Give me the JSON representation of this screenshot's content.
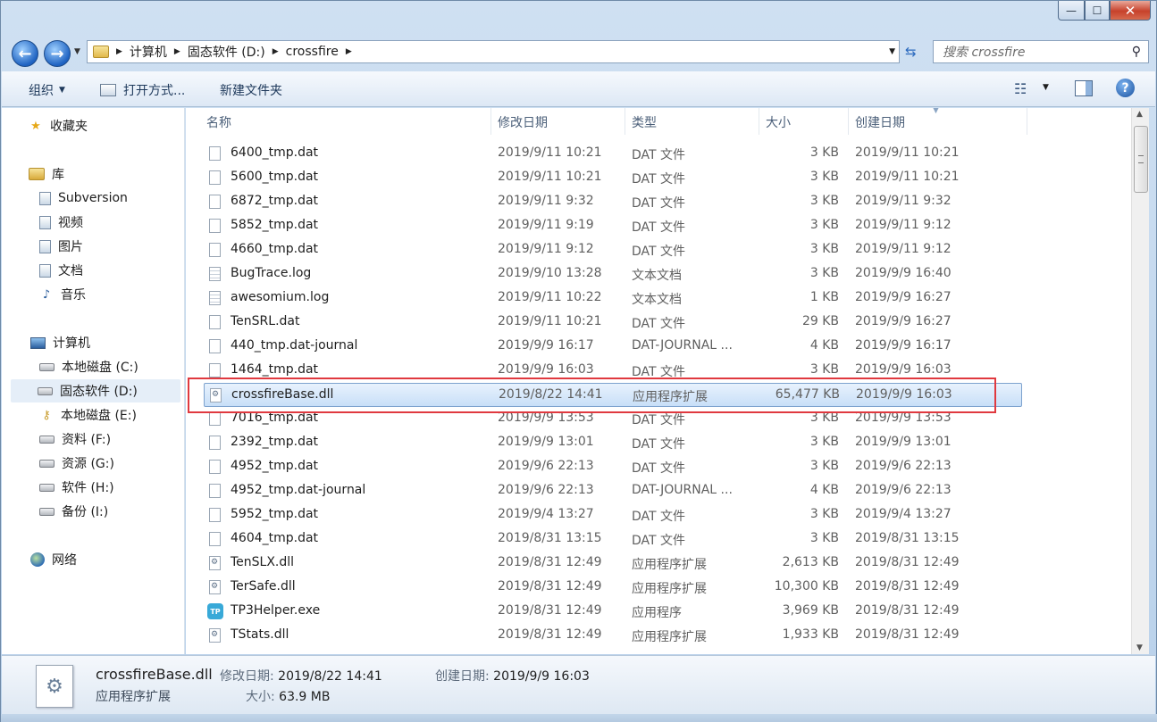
{
  "window": {
    "title": "",
    "controls": {
      "minimize": "—",
      "maximize": "☐",
      "close": "✕"
    }
  },
  "address": {
    "breadcrumbs": [
      "计算机",
      "固态软件 (D:)",
      "crossfire"
    ],
    "search_placeholder": "搜索 crossfire"
  },
  "toolbar": {
    "organize": "组织",
    "open_with": "打开方式...",
    "new_folder": "新建文件夹"
  },
  "nav": {
    "favorites": "收藏夹",
    "libraries": "库",
    "library_items": [
      "Subversion",
      "视频",
      "图片",
      "文档",
      "音乐"
    ],
    "computer": "计算机",
    "drives": [
      "本地磁盘 (C:)",
      "固态软件 (D:)",
      "本地磁盘 (E:)",
      "资料 (F:)",
      "资源 (G:)",
      "软件 (H:)",
      "备份 (I:)"
    ],
    "network": "网络"
  },
  "columns": {
    "name": "名称",
    "modified": "修改日期",
    "type": "类型",
    "size": "大小",
    "created": "创建日期"
  },
  "files": [
    {
      "name": "6400_tmp.dat",
      "modified": "2019/9/11 10:21",
      "type": "DAT 文件",
      "size": "3 KB",
      "created": "2019/9/11 10:21",
      "icon": "file"
    },
    {
      "name": "5600_tmp.dat",
      "modified": "2019/9/11 10:21",
      "type": "DAT 文件",
      "size": "3 KB",
      "created": "2019/9/11 10:21",
      "icon": "file"
    },
    {
      "name": "6872_tmp.dat",
      "modified": "2019/9/11 9:32",
      "type": "DAT 文件",
      "size": "3 KB",
      "created": "2019/9/11 9:32",
      "icon": "file"
    },
    {
      "name": "5852_tmp.dat",
      "modified": "2019/9/11 9:19",
      "type": "DAT 文件",
      "size": "3 KB",
      "created": "2019/9/11 9:12",
      "icon": "file"
    },
    {
      "name": "4660_tmp.dat",
      "modified": "2019/9/11 9:12",
      "type": "DAT 文件",
      "size": "3 KB",
      "created": "2019/9/11 9:12",
      "icon": "file"
    },
    {
      "name": "BugTrace.log",
      "modified": "2019/9/10 13:28",
      "type": "文本文档",
      "size": "3 KB",
      "created": "2019/9/9 16:40",
      "icon": "log"
    },
    {
      "name": "awesomium.log",
      "modified": "2019/9/11 10:22",
      "type": "文本文档",
      "size": "1 KB",
      "created": "2019/9/9 16:27",
      "icon": "log"
    },
    {
      "name": "TenSRL.dat",
      "modified": "2019/9/11 10:21",
      "type": "DAT 文件",
      "size": "29 KB",
      "created": "2019/9/9 16:27",
      "icon": "file"
    },
    {
      "name": "440_tmp.dat-journal",
      "modified": "2019/9/9 16:17",
      "type": "DAT-JOURNAL ...",
      "size": "4 KB",
      "created": "2019/9/9 16:17",
      "icon": "file"
    },
    {
      "name": "1464_tmp.dat",
      "modified": "2019/9/9 16:03",
      "type": "DAT 文件",
      "size": "3 KB",
      "created": "2019/9/9 16:03",
      "icon": "file"
    },
    {
      "name": "crossfireBase.dll",
      "modified": "2019/8/22 14:41",
      "type": "应用程序扩展",
      "size": "65,477 KB",
      "created": "2019/9/9 16:03",
      "icon": "dll",
      "selected": true
    },
    {
      "name": "7016_tmp.dat",
      "modified": "2019/9/9 13:53",
      "type": "DAT 文件",
      "size": "3 KB",
      "created": "2019/9/9 13:53",
      "icon": "file"
    },
    {
      "name": "2392_tmp.dat",
      "modified": "2019/9/9 13:01",
      "type": "DAT 文件",
      "size": "3 KB",
      "created": "2019/9/9 13:01",
      "icon": "file"
    },
    {
      "name": "4952_tmp.dat",
      "modified": "2019/9/6 22:13",
      "type": "DAT 文件",
      "size": "3 KB",
      "created": "2019/9/6 22:13",
      "icon": "file"
    },
    {
      "name": "4952_tmp.dat-journal",
      "modified": "2019/9/6 22:13",
      "type": "DAT-JOURNAL ...",
      "size": "4 KB",
      "created": "2019/9/6 22:13",
      "icon": "file"
    },
    {
      "name": "5952_tmp.dat",
      "modified": "2019/9/4 13:27",
      "type": "DAT 文件",
      "size": "3 KB",
      "created": "2019/9/4 13:27",
      "icon": "file"
    },
    {
      "name": "4604_tmp.dat",
      "modified": "2019/8/31 13:15",
      "type": "DAT 文件",
      "size": "3 KB",
      "created": "2019/8/31 13:15",
      "icon": "file"
    },
    {
      "name": "TenSLX.dll",
      "modified": "2019/8/31 12:49",
      "type": "应用程序扩展",
      "size": "2,613 KB",
      "created": "2019/8/31 12:49",
      "icon": "dll"
    },
    {
      "name": "TerSafe.dll",
      "modified": "2019/8/31 12:49",
      "type": "应用程序扩展",
      "size": "10,300 KB",
      "created": "2019/8/31 12:49",
      "icon": "dll"
    },
    {
      "name": "TP3Helper.exe",
      "modified": "2019/8/31 12:49",
      "type": "应用程序",
      "size": "3,969 KB",
      "created": "2019/8/31 12:49",
      "icon": "exe"
    },
    {
      "name": "TStats.dll",
      "modified": "2019/8/31 12:49",
      "type": "应用程序扩展",
      "size": "1,933 KB",
      "created": "2019/8/31 12:49",
      "icon": "dll"
    }
  ],
  "details": {
    "name": "crossfireBase.dll",
    "type": "应用程序扩展",
    "modified_label": "修改日期:",
    "modified": "2019/8/22 14:41",
    "created_label": "创建日期:",
    "created": "2019/9/9 16:03",
    "size_label": "大小:",
    "size": "63.9 MB"
  }
}
